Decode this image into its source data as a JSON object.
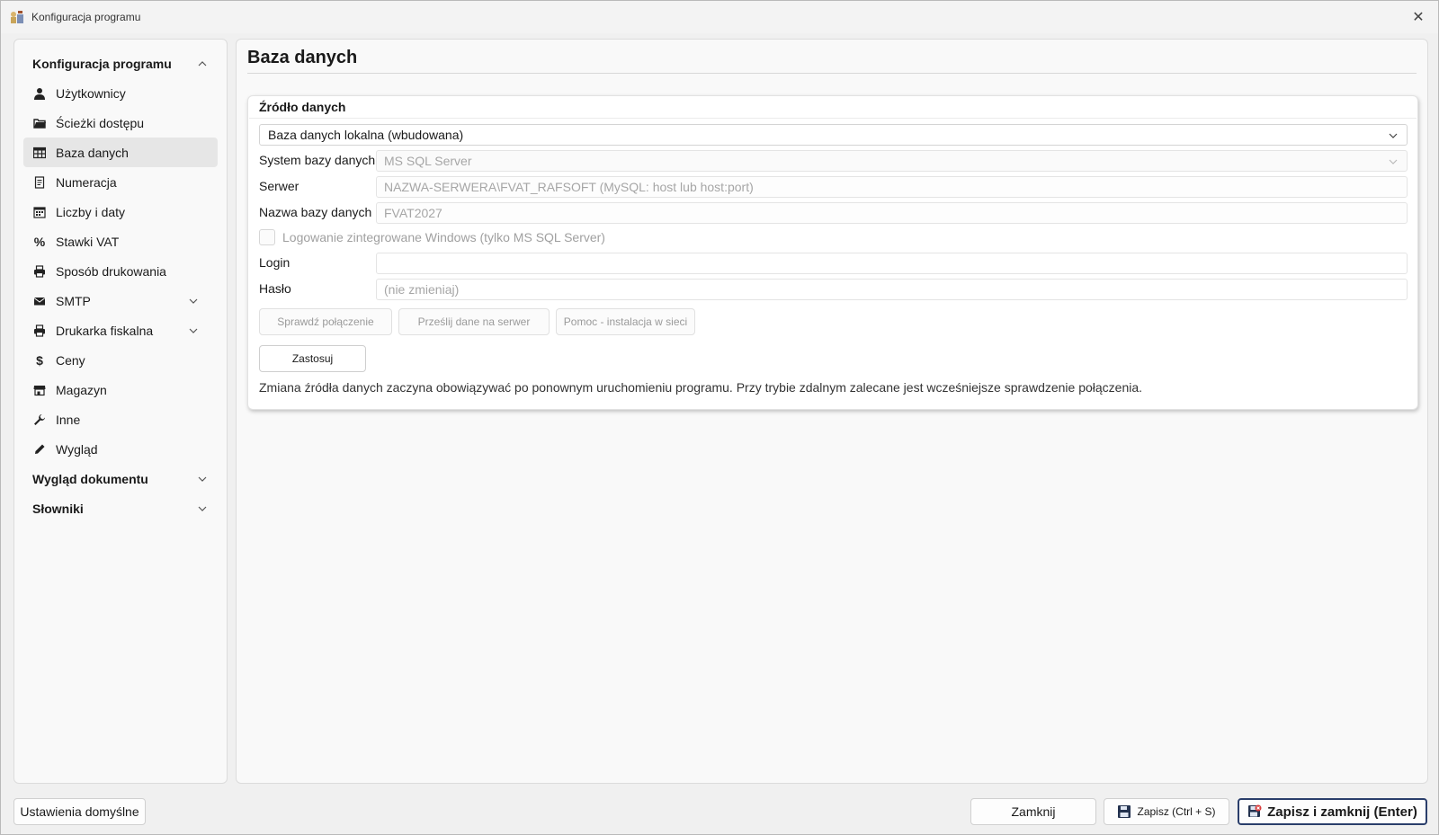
{
  "window": {
    "title": "Konfiguracja programu",
    "close_glyph": "✕"
  },
  "sidebar": {
    "group_config": {
      "label": "Konfiguracja programu",
      "expanded": true
    },
    "items": [
      {
        "label": "Użytkownicy",
        "icon": "user-icon"
      },
      {
        "label": "Ścieżki dostępu",
        "icon": "folder-icon"
      },
      {
        "label": "Baza danych",
        "icon": "table-icon",
        "active": true
      },
      {
        "label": "Numeracja",
        "icon": "document-icon"
      },
      {
        "label": "Liczby i daty",
        "icon": "calendar-icon"
      },
      {
        "label": "Stawki VAT",
        "icon": "percent-icon",
        "glyph": "%"
      },
      {
        "label": "Sposób drukowania",
        "icon": "printer-icon"
      },
      {
        "label": "SMTP",
        "icon": "envelope-icon",
        "expandable": true
      },
      {
        "label": "Drukarka fiskalna",
        "icon": "printer-icon",
        "expandable": true
      },
      {
        "label": "Ceny",
        "icon": "dollar-icon",
        "glyph": "$"
      },
      {
        "label": "Magazyn",
        "icon": "store-icon"
      },
      {
        "label": "Inne",
        "icon": "wrench-icon"
      },
      {
        "label": "Wygląd",
        "icon": "pencil-icon"
      }
    ],
    "group_document": {
      "label": "Wygląd dokumentu",
      "expanded": false
    },
    "group_dictionaries": {
      "label": "Słowniki",
      "expanded": false
    }
  },
  "main": {
    "title": "Baza danych",
    "card": {
      "title": "Źródło danych",
      "source_select": "Baza danych lokalna (wbudowana)",
      "db_system_label": "System bazy danych",
      "db_system_value": "MS SQL Server",
      "server_label": "Serwer",
      "server_placeholder": "NAZWA-SERWERA\\FVAT_RAFSOFT (MySQL: host lub host:port)",
      "dbname_label": "Nazwa bazy danych",
      "dbname_value": "FVAT2027",
      "integrated_login_label": "Logowanie zintegrowane Windows (tylko MS SQL Server)",
      "login_label": "Login",
      "login_value": "",
      "password_label": "Hasło",
      "password_placeholder": "(nie zmieniaj)",
      "btn_check": "Sprawdź połączenie",
      "btn_send": "Prześlij dane na serwer",
      "btn_help": "Pomoc - instalacja w sieci",
      "btn_apply": "Zastosuj",
      "note": "Zmiana źródła danych zaczyna obowiązywać po ponownym uruchomieniu programu. Przy trybie zdalnym zalecane jest wcześniejsze sprawdzenie połączenia."
    }
  },
  "footer": {
    "defaults": "Ustawienia domyślne",
    "close": "Zamknij",
    "save": "Zapisz (Ctrl + S)",
    "save_close": "Zapisz i zamknij (Enter)"
  },
  "colors": {
    "accent_border": "#2a3e6b",
    "active_item_bg": "#e6e6e6"
  }
}
